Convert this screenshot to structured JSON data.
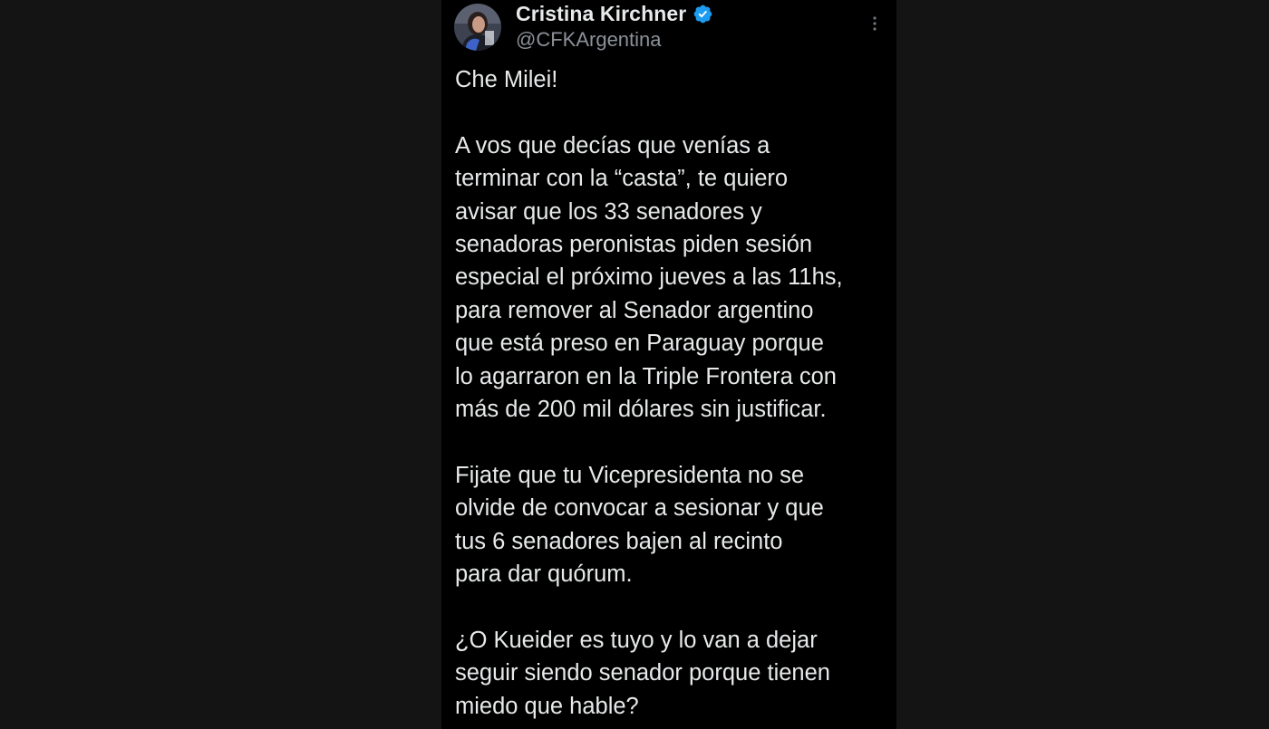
{
  "author": {
    "display_name": "Cristina Kirchner",
    "handle": "@CFKArgentina",
    "verified_icon": "verified-badge-icon",
    "avatar_icon": "profile-photo"
  },
  "menu": {
    "icon": "more-vertical-icon"
  },
  "post": {
    "paragraphs": [
      {
        "lines": [
          "Che Milei!"
        ]
      },
      {
        "lines": [
          "A vos que decías que venías a",
          "terminar con la “casta”, te quiero",
          "avisar que los 33 senadores y",
          "senadoras peronistas piden sesión",
          "especial el próximo jueves a las 11hs,",
          "para remover al Senador argentino",
          "que está preso en Paraguay porque",
          "lo agarraron en la Triple Frontera con",
          "más de 200 mil dólares sin justificar."
        ]
      },
      {
        "lines": [
          "Fijate que tu Vicepresidenta no se",
          "olvide de convocar a sesionar y que",
          "tus 6 senadores bajen al recinto",
          "para dar quórum."
        ]
      },
      {
        "lines": [
          "¿O Kueider es tuyo y lo van a dejar",
          "seguir siendo senador porque tienen",
          "miedo que hable?"
        ]
      }
    ]
  },
  "colors": {
    "background_outer": "#141414",
    "background_post": "#000000",
    "text_primary": "#e7e9ea",
    "text_secondary": "#8b9198",
    "verified_blue": "#1d9bf0"
  }
}
